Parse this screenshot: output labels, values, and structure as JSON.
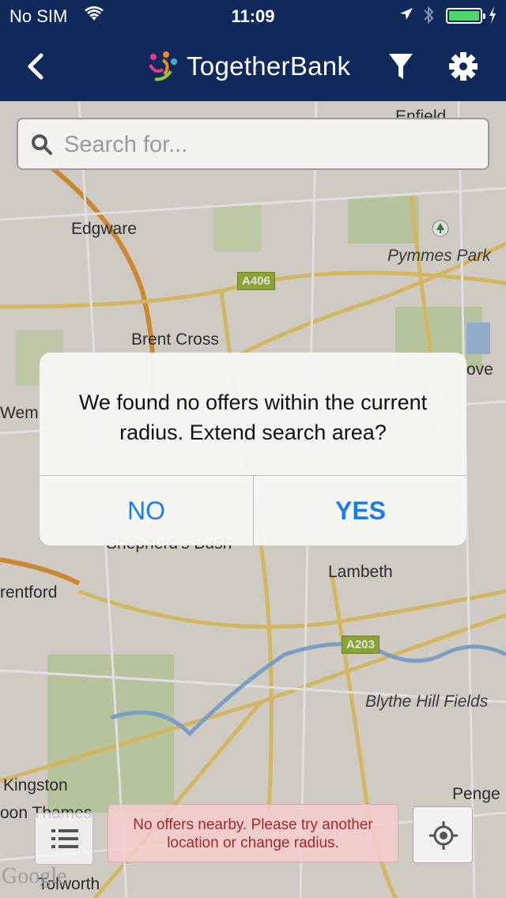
{
  "status_bar": {
    "carrier": "No SIM",
    "time": "11:09",
    "battery_level": 1.0,
    "accent": "#4cd964"
  },
  "nav": {
    "brand": "TogetherBank",
    "icons": [
      "back-chevron-icon",
      "filter-funnel-icon",
      "gear-icon"
    ],
    "background": "#0f2a5a"
  },
  "search": {
    "placeholder": "Search for..."
  },
  "map": {
    "labels": [
      "Edgware",
      "Pymmes Park",
      "Brent Cross",
      "Wem",
      "ove",
      "Lambeth",
      "rentford",
      "Blythe Hill Fields",
      "Kingston",
      "oon Thames",
      "Penge",
      "Tolworth",
      "Enfield",
      "Shepherd's Bush"
    ],
    "road_badges": [
      "A406",
      "A203"
    ],
    "attribution": "Google"
  },
  "toast": {
    "message_line1": "No offers nearby. Please try another",
    "message_line2": "location or change radius."
  },
  "alert": {
    "message": "We found no offers within the current radius. Extend search area?",
    "no_label": "NO",
    "yes_label": "YES",
    "button_color": "#1a7cf5"
  }
}
